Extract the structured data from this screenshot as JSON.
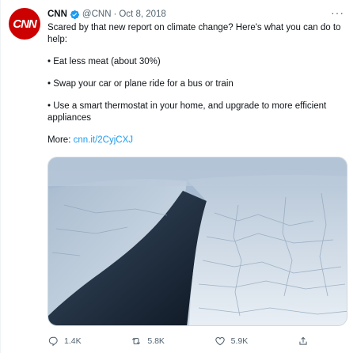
{
  "tweet": {
    "author_name": "CNN",
    "handle": "@CNN",
    "separator": "·",
    "date": "Oct 8, 2018",
    "avatar_text": "CNN",
    "lines": {
      "intro": "Scared by that new report on climate change? Here's what you can do to help:",
      "item1": "• Eat less meat (about 30%)",
      "item2": "• Swap your car or plane ride for a bus or train",
      "item3": "• Use a smart thermostat in your home, and upgrade to more efficient appliances",
      "more_label": "More: ",
      "more_link": "cnn.it/2CyjCXJ"
    },
    "media": {
      "image_semantic": "aerial-view-of-sea-ice"
    },
    "actions": {
      "replies": "1.4K",
      "retweets": "5.8K",
      "likes": "5.9K"
    }
  },
  "colors": {
    "brand_red": "#cc0000",
    "link_blue": "#1d9bf0",
    "muted": "#536471",
    "verified_blue": "#1d9bf0"
  },
  "icons": [
    "verified-badge-icon",
    "more-options-icon",
    "reply-icon",
    "retweet-icon",
    "like-icon",
    "share-icon"
  ]
}
